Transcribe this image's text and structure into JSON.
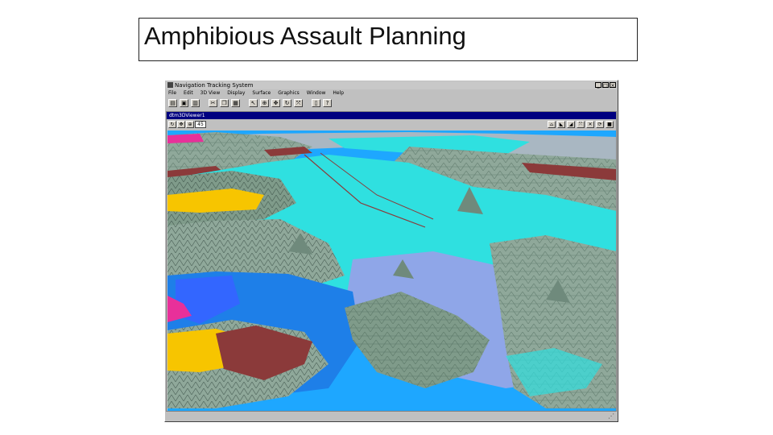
{
  "slide": {
    "title": "Amphibious Assault Planning"
  },
  "window": {
    "title": "Navigation Tracking System",
    "controls": [
      "_",
      "□",
      "×"
    ]
  },
  "menu": [
    "File",
    "Edit",
    "3D View",
    "Display",
    "Surface",
    "Graphics",
    "Window",
    "Help"
  ],
  "toolbar_icons": [
    "open-icon",
    "save-icon",
    "print-icon",
    "cut-icon",
    "copy-icon",
    "paste-icon",
    "select-icon",
    "zoom-icon",
    "pan-icon",
    "rotate-icon",
    "fit-icon",
    "layers-icon",
    "help-icon"
  ],
  "viewer": {
    "title": "dtm3DViewer1",
    "zoom_value": "45",
    "left_tools": [
      "rotate-icon",
      "pan-icon",
      "zoom-icon"
    ],
    "right_tools": [
      "view-top-icon",
      "view-side-icon",
      "view-oblique-icon",
      "fit-icon",
      "reset-icon",
      "refresh-icon",
      "close-icon"
    ]
  },
  "colors": {
    "water_deep": "#1e90ff",
    "water_shallow": "#00e5e5",
    "landing_zone_yellow": "#f7c500",
    "landing_zone_red": "#8b3a3a",
    "zone_magenta": "#e8309a",
    "terrain": "#8fa89a",
    "sky": "#1ea7ff"
  }
}
